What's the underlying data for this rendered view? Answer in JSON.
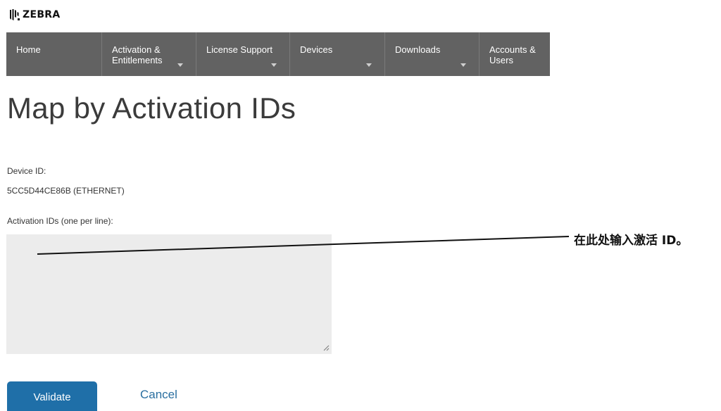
{
  "logo": {
    "text": "ZEBRA",
    "icon": "zebra-head-icon"
  },
  "nav": {
    "items": [
      {
        "label": "Home",
        "has_dropdown": false
      },
      {
        "label": "Activation &\nEntitlements",
        "has_dropdown": true
      },
      {
        "label": "License Support",
        "has_dropdown": true
      },
      {
        "label": "Devices",
        "has_dropdown": true
      },
      {
        "label": "Downloads",
        "has_dropdown": true
      },
      {
        "label": "Accounts &\nUsers",
        "has_dropdown": false
      }
    ]
  },
  "page": {
    "title": "Map by Activation IDs"
  },
  "device": {
    "label": "Device ID:",
    "value": "5CC5D44CE86B (ETHERNET)"
  },
  "activation": {
    "label": "Activation IDs (one per line):",
    "value": ""
  },
  "actions": {
    "validate_label": "Validate",
    "cancel_label": "Cancel"
  },
  "callout": {
    "text": "在此处输入激活 ID。"
  },
  "colors": {
    "nav_background": "#626262",
    "primary_button": "#1f6fa8",
    "link": "#2a6fa0",
    "textarea_background": "#ececec"
  }
}
